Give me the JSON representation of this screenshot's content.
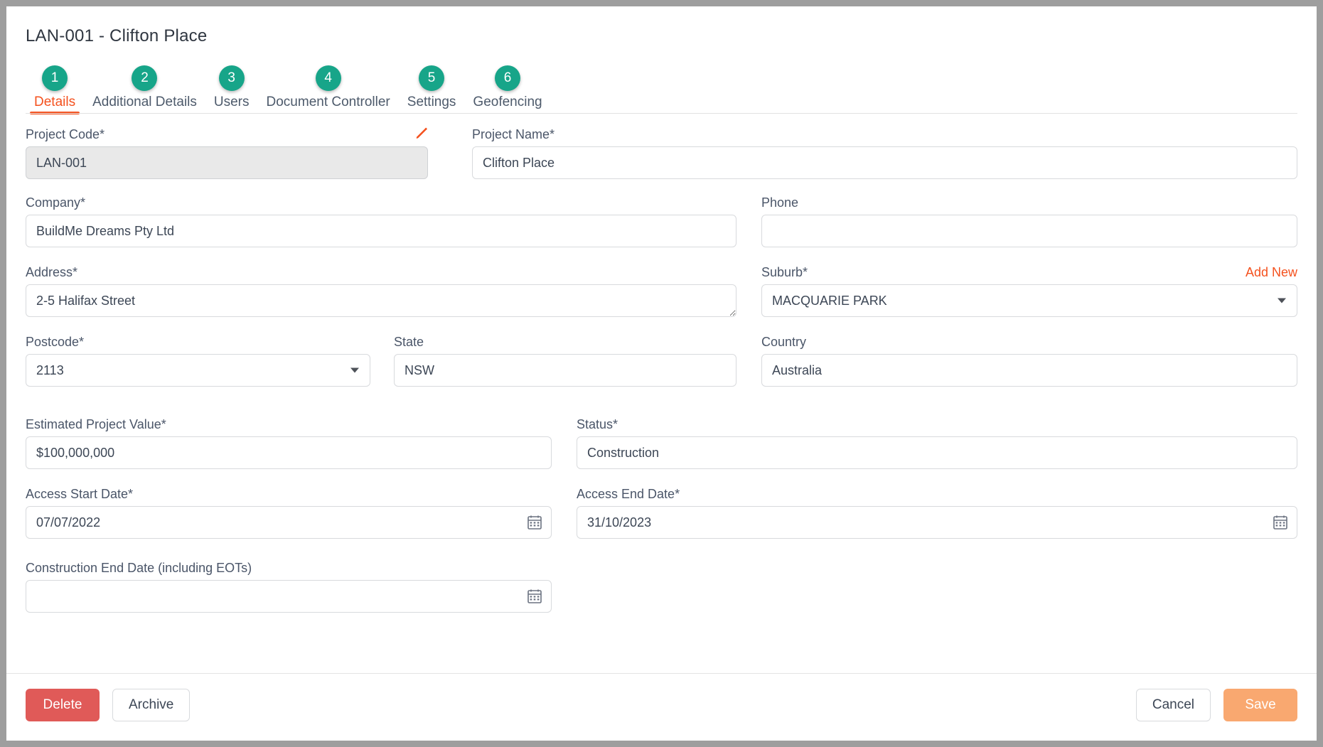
{
  "header": {
    "title": "LAN-001 - Clifton Place"
  },
  "tabs": [
    {
      "badge": "1",
      "label": "Details",
      "active": true
    },
    {
      "badge": "2",
      "label": "Additional Details",
      "active": false
    },
    {
      "badge": "3",
      "label": "Users",
      "active": false
    },
    {
      "badge": "4",
      "label": "Document Controller",
      "active": false
    },
    {
      "badge": "5",
      "label": "Settings",
      "active": false
    },
    {
      "badge": "6",
      "label": "Geofencing",
      "active": false
    }
  ],
  "form": {
    "project_code": {
      "label": "Project Code*",
      "value": "LAN-001",
      "edit_icon": "pencil-icon"
    },
    "project_name": {
      "label": "Project Name*",
      "value": "Clifton Place"
    },
    "company": {
      "label": "Company*",
      "value": "BuildMe Dreams Pty Ltd"
    },
    "phone": {
      "label": "Phone",
      "value": ""
    },
    "address": {
      "label": "Address*",
      "value": "2-5 Halifax Street"
    },
    "suburb": {
      "label": "Suburb*",
      "value": "MACQUARIE PARK",
      "add_new_label": "Add New"
    },
    "postcode": {
      "label": "Postcode*",
      "value": "2113"
    },
    "state": {
      "label": "State",
      "value": "NSW"
    },
    "country": {
      "label": "Country",
      "value": "Australia"
    },
    "estimated_project_value": {
      "label": "Estimated Project Value*",
      "value": "$100,000,000"
    },
    "status": {
      "label": "Status*",
      "value": "Construction"
    },
    "access_start_date": {
      "label": "Access Start Date*",
      "value": "07/07/2022"
    },
    "access_end_date": {
      "label": "Access End Date*",
      "value": "31/10/2023"
    },
    "construction_end_date": {
      "label": "Construction End Date (including EOTs)",
      "value": ""
    }
  },
  "footer": {
    "delete_label": "Delete",
    "archive_label": "Archive",
    "cancel_label": "Cancel",
    "save_label": "Save"
  },
  "colors": {
    "tab_badge": "#17a589",
    "accent_orange": "#f4511e",
    "delete_red": "#e05a58",
    "save_orange": "#f9a870"
  }
}
